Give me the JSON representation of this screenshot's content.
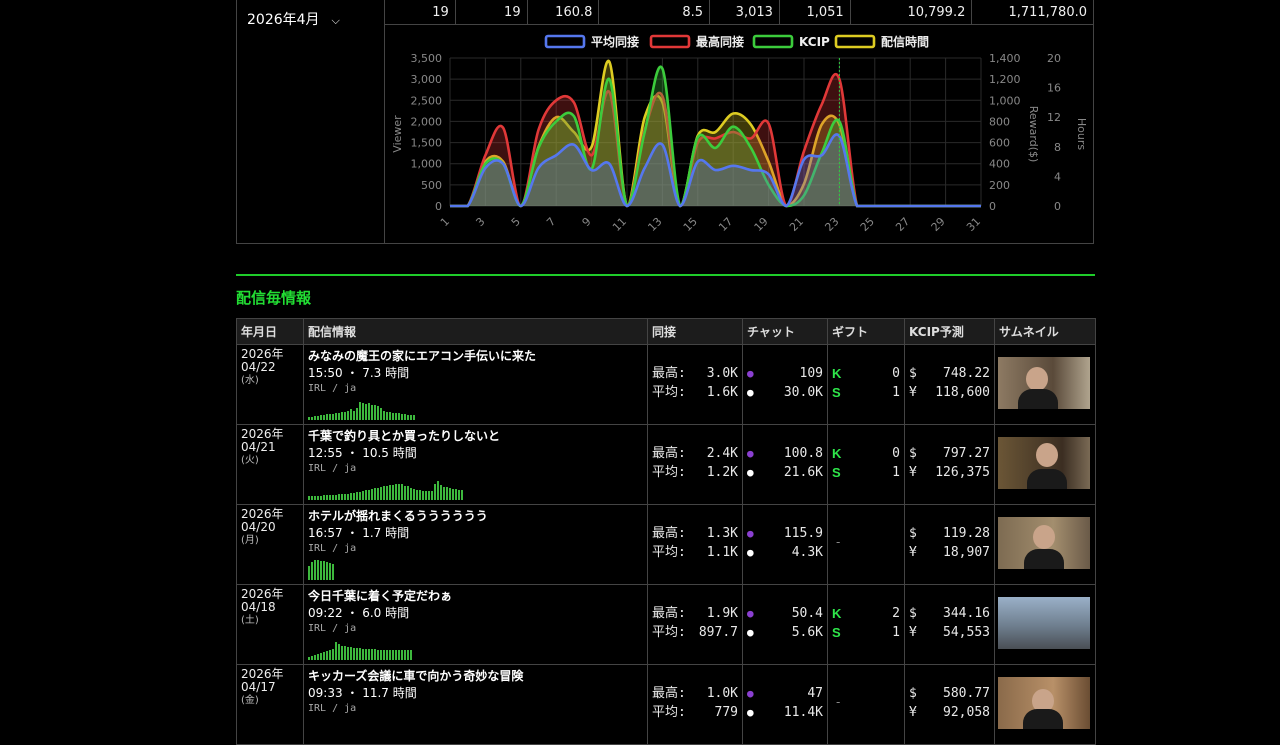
{
  "summary": {
    "month": "2026年4月",
    "stats": [
      "19",
      "19",
      "160.8",
      "8.5",
      "3,013",
      "1,051",
      "10,799.2",
      "1,711,780.0"
    ]
  },
  "chart_data": {
    "type": "area",
    "legend": [
      "平均同接",
      "最高同接",
      "KCIP",
      "配信時間"
    ],
    "colors": {
      "avg": "#5577ee",
      "max": "#e03838",
      "kcip": "#3ccc3c",
      "hours": "#ddcc22"
    },
    "x_ticks": [
      "1",
      "3",
      "5",
      "7",
      "9",
      "11",
      "13",
      "15",
      "17",
      "19",
      "21",
      "23",
      "25",
      "27",
      "29",
      "31"
    ],
    "y_left": {
      "label": "Viewer",
      "ticks": [
        "3,500",
        "3,000",
        "2,500",
        "2,000",
        "1,500",
        "1,000",
        "500",
        "0"
      ],
      "ylim": [
        0,
        3500
      ]
    },
    "y_reward": {
      "label": "Reward($)",
      "ticks": [
        "1,400",
        "1,200",
        "1,000",
        "800",
        "600",
        "400",
        "200",
        "0"
      ],
      "ylim": [
        0,
        1400
      ]
    },
    "y_hours": {
      "label": "Hours",
      "ticks": [
        "20",
        "16",
        "12",
        "8",
        "4",
        "0"
      ],
      "ylim": [
        0,
        20
      ]
    },
    "x": [
      1,
      2,
      3,
      4,
      5,
      6,
      7,
      8,
      9,
      10,
      11,
      12,
      13,
      14,
      15,
      16,
      17,
      18,
      19,
      20,
      21,
      22,
      23,
      24,
      25,
      26,
      27,
      28,
      29,
      30,
      31
    ],
    "series": [
      {
        "name": "平均同接",
        "key": "avg",
        "values": [
          0,
          0,
          900,
          1000,
          0,
          900,
          1200,
          1450,
          850,
          1000,
          0,
          900,
          1450,
          0,
          1050,
          850,
          950,
          850,
          750,
          0,
          1100,
          1200,
          1650,
          0,
          0,
          0,
          0,
          0,
          0,
          0,
          0
        ]
      },
      {
        "name": "最高同接",
        "key": "max",
        "values": [
          0,
          0,
          1200,
          1850,
          0,
          1800,
          2500,
          2450,
          1200,
          2700,
          0,
          1800,
          2600,
          0,
          1500,
          1600,
          1750,
          1600,
          1950,
          0,
          1300,
          2400,
          3000,
          0,
          0,
          0,
          0,
          0,
          0,
          0,
          0
        ]
      },
      {
        "name": "KCIP",
        "key": "kcip",
        "values": [
          0,
          0,
          400,
          400,
          0,
          550,
          800,
          850,
          350,
          1200,
          0,
          700,
          1300,
          0,
          650,
          550,
          750,
          550,
          200,
          0,
          100,
          500,
          800,
          0,
          0,
          0,
          0,
          0,
          0,
          0,
          0
        ]
      },
      {
        "name": "配信時間",
        "key": "hours",
        "values": [
          0,
          0,
          6,
          6,
          0,
          8,
          12,
          10,
          8,
          19.5,
          0,
          12,
          14,
          0,
          9.5,
          10,
          12.5,
          11,
          6,
          0,
          3,
          11,
          11,
          0,
          0,
          0,
          0,
          0,
          0,
          0,
          0
        ]
      }
    ]
  },
  "section": {
    "title": "配信毎情報"
  },
  "table": {
    "headers": [
      "年月日",
      "配信情報",
      "同接",
      "チャット",
      "ギフト",
      "KCIP予測",
      "サムネイル"
    ],
    "labels": {
      "max": "最高:",
      "avg": "平均:",
      "usd": "$",
      "jpy": "¥",
      "k": "K",
      "s": "S",
      "dash": "-"
    },
    "rows": [
      {
        "year": "2026年",
        "md": "04/22",
        "dow": "(水)",
        "title": "みなみの魔王の家にエアコン手伝いに来た",
        "time": "15:50 ・ 7.3 時間",
        "cat": "IRL / ja",
        "max": "3.0K",
        "avg": "1.6K",
        "chat1": "109",
        "chat2": "30.0K",
        "gift_k": "0",
        "gift_s": "1",
        "usd": "748.22",
        "jpy": "118,600",
        "spark": [
          3,
          3,
          4,
          4,
          5,
          5,
          6,
          6,
          6,
          7,
          7,
          8,
          8,
          9,
          11,
          9,
          12,
          18,
          17,
          16,
          17,
          15,
          15,
          14,
          12,
          9,
          8,
          8,
          7,
          7,
          7,
          6,
          6,
          5,
          5,
          5
        ]
      },
      {
        "year": "2026年",
        "md": "04/21",
        "dow": "(火)",
        "title": "千葉で釣り具とか買ったりしないと",
        "time": "12:55 ・ 10.5 時間",
        "cat": "IRL / ja",
        "max": "2.4K",
        "avg": "1.2K",
        "chat1": "100.8",
        "chat2": "21.6K",
        "gift_k": "0",
        "gift_s": "1",
        "usd": "797.27",
        "jpy": "126,375",
        "spark": [
          4,
          4,
          4,
          4,
          4,
          5,
          5,
          5,
          5,
          5,
          6,
          6,
          6,
          6,
          7,
          7,
          8,
          8,
          9,
          10,
          10,
          11,
          12,
          12,
          13,
          14,
          14,
          15,
          15,
          16,
          16,
          16,
          14,
          14,
          12,
          11,
          10,
          10,
          9,
          9,
          9,
          9,
          16,
          19,
          15,
          13,
          13,
          12,
          11,
          11,
          10,
          10
        ]
      },
      {
        "year": "2026年",
        "md": "04/20",
        "dow": "(月)",
        "title": "ホテルが揺れまくるうううううう",
        "time": "16:57 ・ 1.7 時間",
        "cat": "IRL / ja",
        "max": "1.3K",
        "avg": "1.1K",
        "chat1": "115.9",
        "chat2": "4.3K",
        "gift_k": "",
        "gift_s": "",
        "usd": "119.28",
        "jpy": "18,907",
        "spark": [
          14,
          18,
          20,
          20,
          19,
          19,
          18,
          17,
          16
        ]
      },
      {
        "year": "2026年",
        "md": "04/18",
        "dow": "(土)",
        "title": "今日千葉に着く予定だわぁ",
        "time": "09:22 ・ 6.0 時間",
        "cat": "IRL / ja",
        "max": "1.9K",
        "avg": "897.7",
        "chat1": "50.4",
        "chat2": "5.6K",
        "gift_k": "2",
        "gift_s": "1",
        "usd": "344.16",
        "jpy": "54,553",
        "spark": [
          3,
          4,
          5,
          6,
          7,
          8,
          9,
          10,
          11,
          18,
          16,
          14,
          14,
          13,
          13,
          12,
          12,
          12,
          11,
          11,
          11,
          11,
          11,
          10,
          10,
          10,
          10,
          10,
          10,
          10,
          10,
          10,
          10,
          10,
          10
        ]
      },
      {
        "year": "2026年",
        "md": "04/17",
        "dow": "(金)",
        "title": "キッカーズ会議に車で向かう奇妙な冒険",
        "time": "09:33 ・ 11.7 時間",
        "cat": "IRL / ja",
        "max": "1.0K",
        "avg": "779",
        "chat1": "47",
        "chat2": "11.4K",
        "gift_k": "",
        "gift_s": "",
        "usd": "580.77",
        "jpy": "92,058",
        "spark": []
      }
    ]
  }
}
